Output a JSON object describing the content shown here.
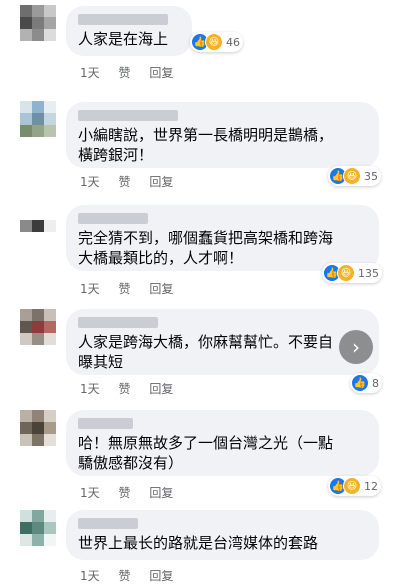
{
  "comments": [
    {
      "text": "人家是在海上",
      "time": "1天",
      "like": "赞",
      "reply": "回复",
      "reaction_count": "46",
      "reactions": [
        "like-icon",
        "haha-icon"
      ]
    },
    {
      "text": "小編瞎說，世界第一長橋明明是鵲橋，\n橫跨銀河！",
      "time": "1天",
      "like": "赞",
      "reply": "回复",
      "reaction_count": "35",
      "reactions": [
        "like-icon",
        "haha-icon"
      ]
    },
    {
      "text": "完全猜不到，哪個蠢貨把高架橋和跨海\n大橋最類比的，人才啊！",
      "time": "1天",
      "like": "赞",
      "reply": "回复",
      "reaction_count": "135",
      "reactions": [
        "like-icon",
        "haha-icon"
      ]
    },
    {
      "text": "人家是跨海大橋，你麻幫幫忙。不要自\n曝其短",
      "time": "1天",
      "like": "赞",
      "reply": "回复",
      "reaction_count": "8",
      "reactions": [
        "like-icon"
      ]
    },
    {
      "text": "哈！無原無故多了一個台灣之光（一點\n驕傲感都沒有）",
      "time": "1天",
      "like": "赞",
      "reply": "回复",
      "reaction_count": "12",
      "reactions": [
        "like-icon",
        "haha-icon"
      ]
    },
    {
      "text": "世界上最长的路就是台湾媒体的套路",
      "time": "1天",
      "like": "赞",
      "reply": "回复",
      "reaction_count": "",
      "reactions": []
    }
  ],
  "colors": {
    "like": "#1877f2",
    "haha": "#f7b125",
    "bubble": "#f0f2f5",
    "meta": "#65676b"
  }
}
